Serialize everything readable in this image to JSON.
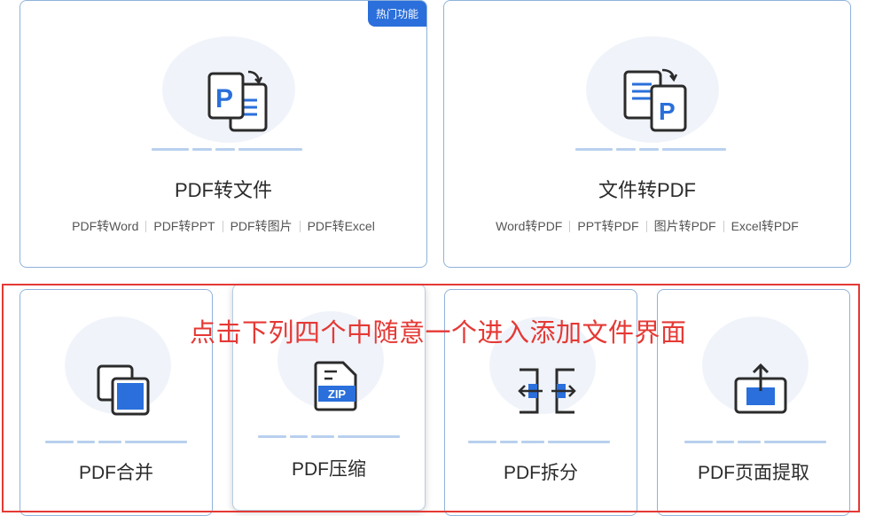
{
  "top_cards": [
    {
      "badge": "热门功能",
      "title": "PDF转文件",
      "links": [
        "PDF转Word",
        "PDF转PPT",
        "PDF转图片",
        "PDF转Excel"
      ],
      "icon": "pdf-to-file-icon"
    },
    {
      "title": "文件转PDF",
      "links": [
        "Word转PDF",
        "PPT转PDF",
        "图片转PDF",
        "Excel转PDF"
      ],
      "icon": "file-to-pdf-icon"
    }
  ],
  "bottom_cards": [
    {
      "title": "PDF合并",
      "icon": "merge-icon"
    },
    {
      "title": "PDF压缩",
      "icon": "zip-icon",
      "icon_text": "ZIP"
    },
    {
      "title": "PDF拆分",
      "icon": "split-icon"
    },
    {
      "title": "PDF页面提取",
      "icon": "extract-icon"
    }
  ],
  "annotation": {
    "text": "点击下列四个中随意一个进入添加文件界面",
    "color": "#e53935"
  },
  "colors": {
    "accent": "#2a6fdb",
    "border": "#8fb3da"
  }
}
